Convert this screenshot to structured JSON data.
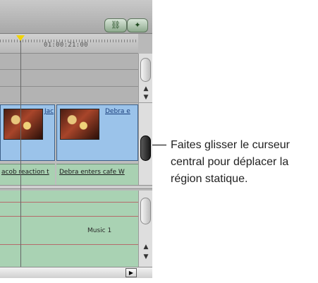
{
  "timeline": {
    "timecode": "01:00:21:00",
    "clips": [
      {
        "name": "Jac",
        "audio_label_prefix": "acob reaction t",
        "audio_label_suffix": ""
      },
      {
        "name": "Debra e",
        "audio_label_prefix": "Debra enters cafe W",
        "audio_label_suffix": ""
      }
    ],
    "audio_track_label": "Music 1"
  },
  "annotation": {
    "text": "Faites glisser le curseur central pour déplacer la région statique."
  },
  "colors": {
    "clip_fill": "#9bc3ea",
    "audio_fill": "#a9d1b2",
    "playhead": "#f2d400",
    "button_fill": "#8eaa8e"
  },
  "icons": {
    "button_left": "link-icon",
    "button_right": "snap-icon",
    "scroll_up": "arrow-up-icon",
    "scroll_down": "arrow-down-icon",
    "scroll_right": "arrow-right-icon"
  }
}
